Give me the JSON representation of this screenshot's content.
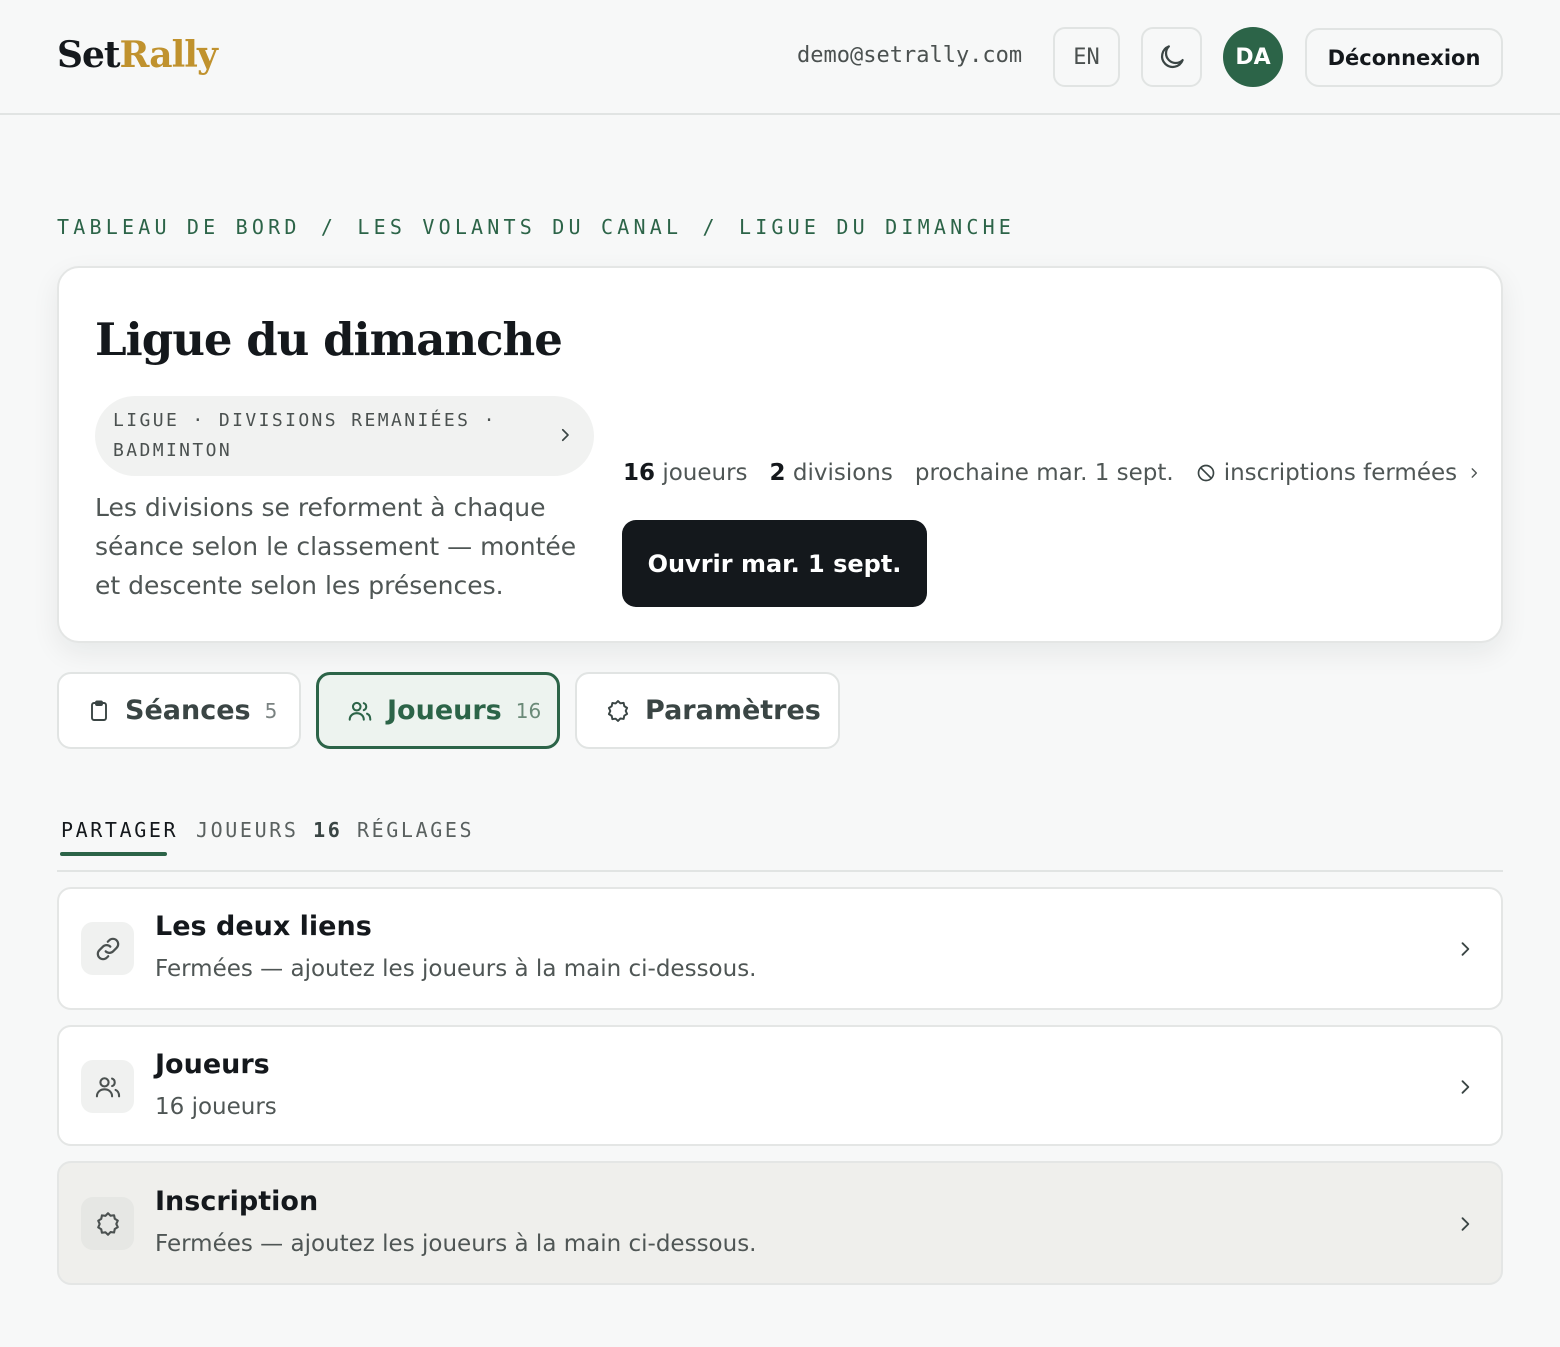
{
  "header": {
    "brand_part1": "Set",
    "brand_part2": "Rally",
    "user_email": "demo@setrally.com",
    "lang_label": "EN",
    "theme_icon": "moon-icon",
    "avatar_initials": "DA",
    "logout_label": "Déconnexion"
  },
  "breadcrumb": {
    "items": [
      "TABLEAU DE BORD",
      "LES VOLANTS DU CANAL",
      "LIGUE DU DIMANCHE"
    ],
    "separator": "/"
  },
  "hero": {
    "title": "Ligue du dimanche",
    "type_pill": "LIGUE · DIVISIONS REMANIÉES · BADMINTON",
    "description": "Les divisions se reforment à chaque séance selon le classement — montée et descente selon les présences.",
    "stats": {
      "players_count": "16",
      "players_label": "joueurs",
      "divisions_count": "2",
      "divisions_label": "divisions",
      "next_session": "prochaine mar. 1 sept.",
      "registration_status": "inscriptions fermées"
    },
    "open_button": "Ouvrir mar. 1 sept."
  },
  "section_tabs": [
    {
      "label": "Séances",
      "count": "5",
      "icon": "clipboard-icon"
    },
    {
      "label": "Joueurs",
      "count": "16",
      "icon": "users-icon",
      "active": true
    },
    {
      "label": "Paramètres",
      "count": "",
      "icon": "gear-icon"
    }
  ],
  "sub_tabs": {
    "share": "PARTAGER",
    "players": "JOUEURS",
    "players_count": "16",
    "settings": "RÉGLAGES",
    "active": "PARTAGER"
  },
  "rows": [
    {
      "title": "Les deux liens",
      "subtitle": "Fermées — ajoutez les joueurs à la main ci-dessous.",
      "icon": "link-icon"
    },
    {
      "title": "Joueurs",
      "subtitle": "16 joueurs",
      "icon": "users-icon"
    },
    {
      "title": "Inscription",
      "subtitle": "Fermées — ajoutez les joueurs à la main ci-dessous.",
      "icon": "gear-icon"
    }
  ],
  "colors": {
    "accent": "#2c6448",
    "brand_gold": "#c0922e",
    "primary_dark": "#14181c",
    "background": "#f7f8f8"
  }
}
